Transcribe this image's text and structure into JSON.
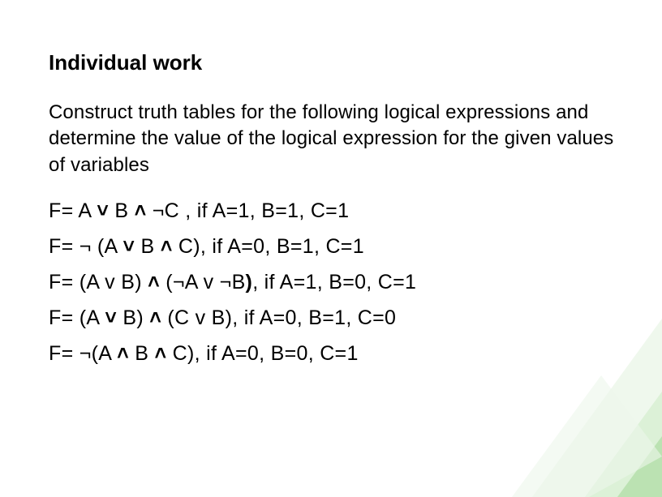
{
  "heading": "Individual work",
  "instruction": "Construct truth tables for the following logical expressions and determine the value of the logical expression for the given values of variables",
  "expressions": [
    {
      "prefix": "F= A ",
      "op1": "˅",
      "mid1": " B ",
      "op2": "˄",
      "mid2": " ",
      "neg": "¬",
      "rest": "C , if A=1, B=1, C=1"
    },
    {
      "prefix": "F= ",
      "neg1": "¬",
      "mid0": " (A ",
      "op1": "˅",
      "mid1": " B ",
      "op2": "˄",
      "rest": " C), if A=0, B=1, C=1"
    },
    {
      "prefix": "F= (A v B) ",
      "op1": "˄",
      "mid1": " (",
      "neg1": "¬",
      "mid2": "A v ",
      "neg2": "¬",
      "mid3": "B",
      "bold1": ")",
      "rest": ", if A=1, B=0, C=1"
    },
    {
      "prefix": "F= (A ",
      "op1": "˅",
      "mid1": " B) ",
      "op2": "˄",
      "rest": " (C v B), if A=0, B=1, C=0"
    },
    {
      "prefix": "F= ",
      "neg1": "¬",
      "mid0": "(A ",
      "op1": "˄",
      "mid1": " B ",
      "op2": "˄",
      "rest": " C), if A=0, B=0, C=1"
    }
  ],
  "colors": {
    "shape_fill": "#e8f5e9",
    "shape_stroke": "#a5d6a7",
    "shape_dark": "#66bb6a"
  }
}
